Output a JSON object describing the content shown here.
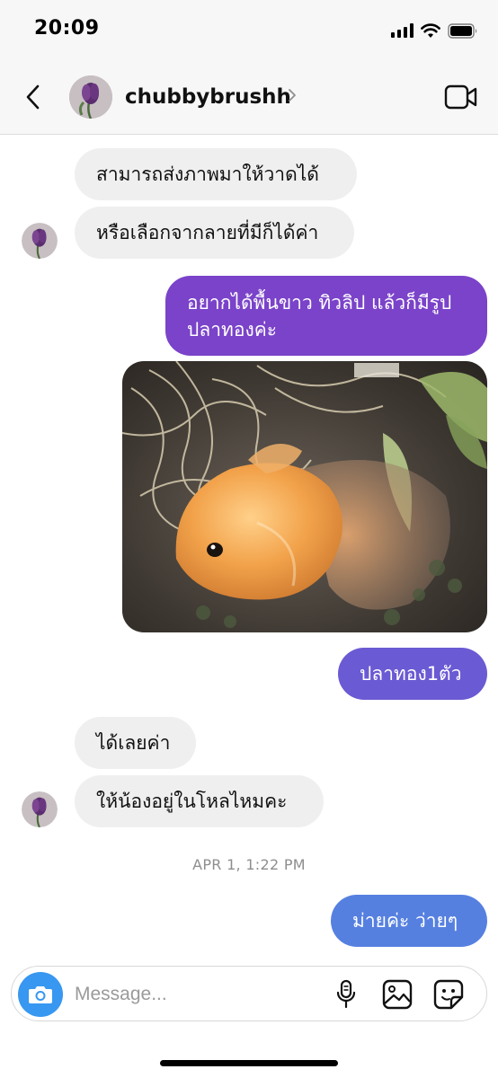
{
  "status_bar": {
    "time": "20:09"
  },
  "header": {
    "username": "chubbybrushh"
  },
  "messages": [
    {
      "sender": "them",
      "text": "สามารถส่งภาพมาให้วาดได้"
    },
    {
      "sender": "them",
      "text": "หรือเลือกจากลายที่มีก็ได้ค่า"
    },
    {
      "sender": "me",
      "text_line1": "อยากได้พื้นขาว ทิวลิป แล้วก็มีรูป",
      "text_line2": "ปลาทองค่ะ"
    },
    {
      "sender": "me",
      "type": "photo",
      "subject": "goldfish"
    },
    {
      "sender": "me",
      "text": "ปลาทอง1ตัว"
    },
    {
      "sender": "them",
      "text": "ได้เลยค่า"
    },
    {
      "sender": "them",
      "text": "ให้น้องอยู่ในโหลไหมคะ"
    },
    {
      "sender": "me",
      "text": "ม่ายค่ะ ว่ายๆ"
    }
  ],
  "timestamp": "APR 1, 1:22 PM",
  "composer": {
    "placeholder": "Message..."
  },
  "icons": {
    "back": "chevron-left-icon",
    "video": "video-camera-icon",
    "camera": "camera-icon",
    "mic": "microphone-icon",
    "gallery": "image-icon",
    "sticker": "sticker-icon"
  },
  "colors": {
    "incoming_bubble": "#efefef",
    "outgoing_purple": "#7a43c9",
    "outgoing_indigo": "#6a5ad3",
    "outgoing_blue": "#5680e0",
    "camera_button": "#3897f0",
    "timestamp": "#8e8e8e"
  }
}
